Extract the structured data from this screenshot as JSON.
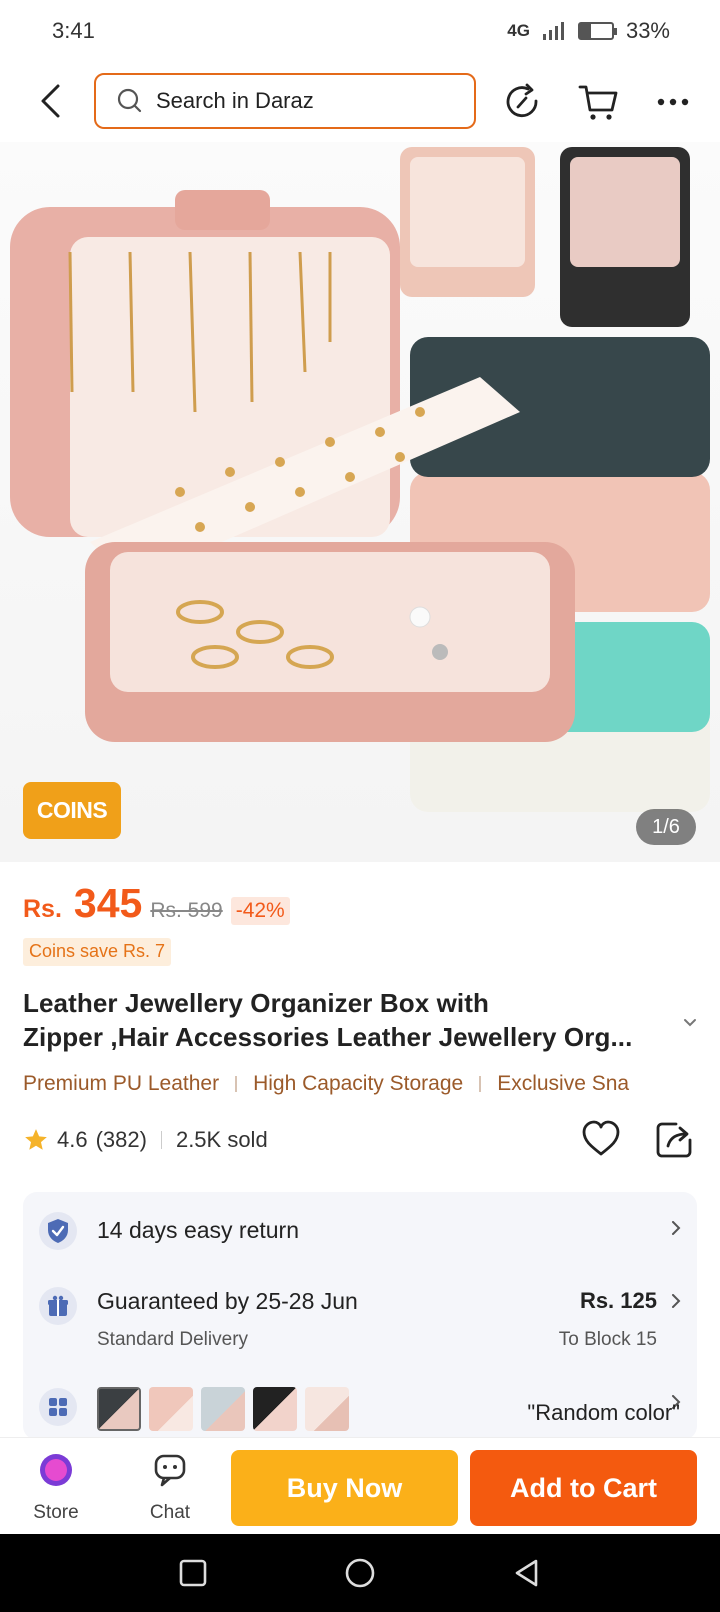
{
  "status_bar": {
    "time": "3:41",
    "network": "4G",
    "battery": "33%",
    "battery_level": 0.33
  },
  "header": {
    "search_placeholder": "Search in Daraz"
  },
  "gallery": {
    "coins_badge": "COINS",
    "counter": "1/6"
  },
  "price": {
    "currency": "Rs.",
    "current": "345",
    "original": "Rs. 599",
    "discount": "-42%",
    "coins_save": "Coins save Rs. 7"
  },
  "product": {
    "title_line1": "Leather Jewellery Organizer Box with",
    "title_line2": "Zipper ,Hair Accessories Leather Jewellery Org...",
    "tags": [
      "Premium PU Leather",
      "High Capacity Storage",
      "Exclusive Sna"
    ]
  },
  "rating": {
    "score": "4.6",
    "count": "(382)",
    "sold": "2.5K sold"
  },
  "info": {
    "returns": "14 days easy return",
    "delivery_title": "Guaranteed by 25-28 Jun",
    "delivery_sub": "Standard Delivery",
    "delivery_price": "Rs. 125",
    "delivery_location": "To Block 15",
    "variant": "\"Random color\""
  },
  "bottom_bar": {
    "store": "Store",
    "chat": "Chat",
    "buy_now": "Buy Now",
    "add_to_cart": "Add to Cart"
  },
  "colors": {
    "accent": "#f25a1a",
    "buy_now": "#fbb019",
    "add_to_cart": "#f45a0f",
    "coins": "#f0a019"
  }
}
